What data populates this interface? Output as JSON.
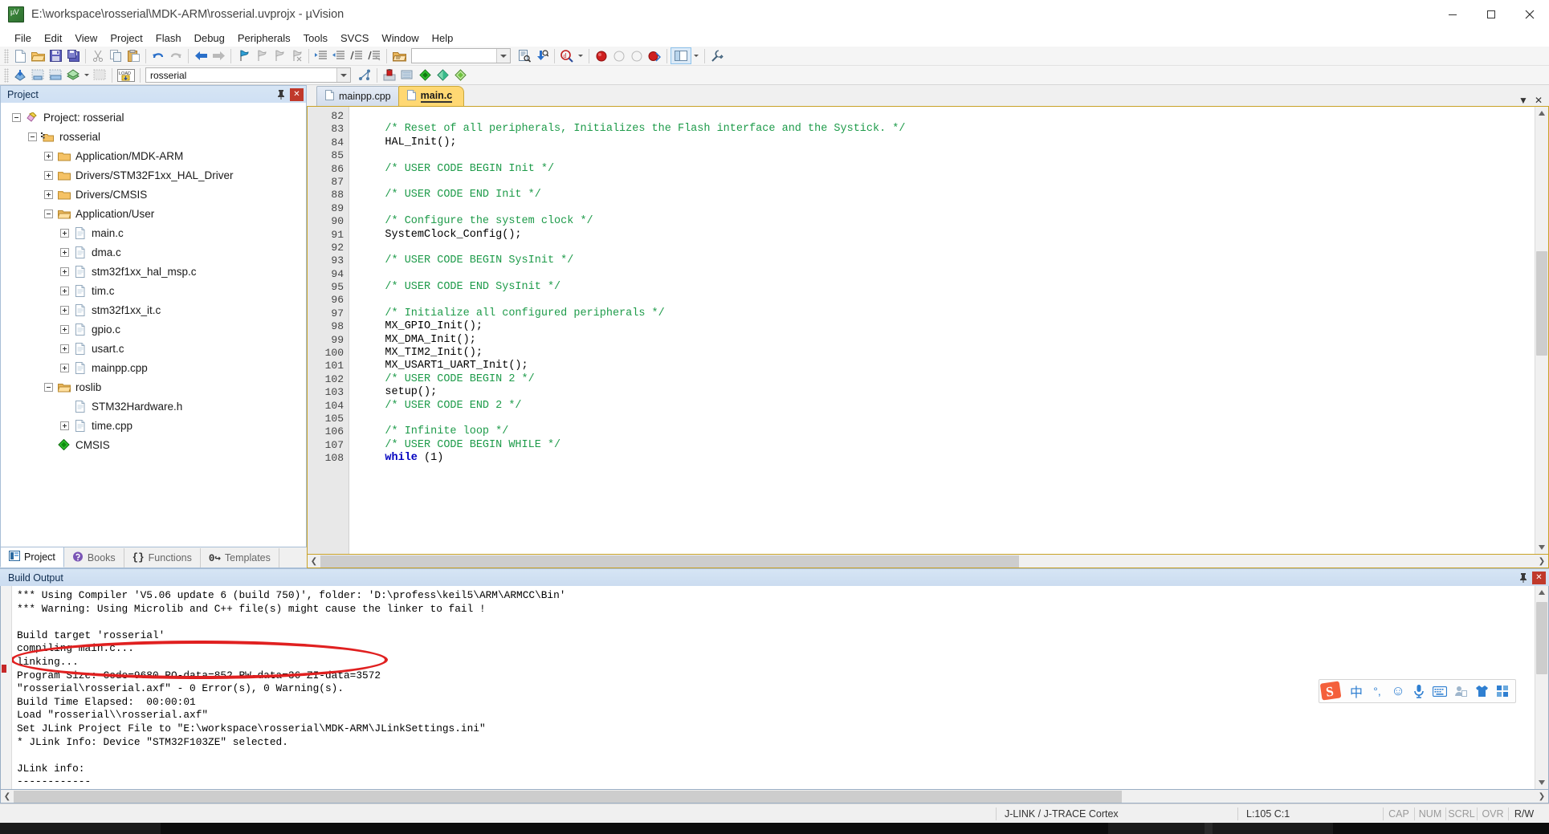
{
  "window": {
    "title": "E:\\workspace\\rosserial\\MDK-ARM\\rosserial.uvprojx - µVision",
    "app_icon": "uvision-icon",
    "minimize_label": "Minimize",
    "maximize_label": "Maximize",
    "close_label": "Close"
  },
  "menubar": {
    "items": [
      {
        "label": "File"
      },
      {
        "label": "Edit"
      },
      {
        "label": "View"
      },
      {
        "label": "Project"
      },
      {
        "label": "Flash"
      },
      {
        "label": "Debug"
      },
      {
        "label": "Peripherals"
      },
      {
        "label": "Tools"
      },
      {
        "label": "SVCS"
      },
      {
        "label": "Window"
      },
      {
        "label": "Help"
      }
    ]
  },
  "toolbar_main": {
    "icons": [
      "new-file-icon",
      "open-file-icon",
      "save-icon",
      "save-all-icon",
      "cut-icon",
      "copy-icon",
      "paste-icon",
      "undo-icon",
      "redo-icon",
      "navigate-back-icon",
      "navigate-forward-icon",
      "bookmark-toggle-icon",
      "bookmark-prev-icon",
      "bookmark-next-icon",
      "bookmark-clear-icon",
      "indent-icon",
      "outdent-icon",
      "comment-icon",
      "uncomment-icon",
      "open-folder-icon"
    ],
    "search_box_value": "",
    "search_box_placeholder": "",
    "right_icons": [
      "find-in-files-icon",
      "incremental-find-icon",
      "search-target-icon",
      "debug-start-icon"
    ]
  },
  "toolbar_build": {
    "icons": [
      "translate-icon",
      "build-icon",
      "rebuild-icon",
      "batch-build-icon",
      "stop-build-icon",
      "download-icon"
    ],
    "target_select_value": "rosserial",
    "right_icons": [
      "target-options-icon",
      "manage-runtime-icon",
      "pack-installer-icon",
      "configure-icon",
      "environment-icon"
    ]
  },
  "project_panel": {
    "title": "Project",
    "pin_icon": "pin-icon",
    "close_icon": "close-icon",
    "tree": [
      {
        "label": "Project: rosserial",
        "depth": 0,
        "icon": "project-icon",
        "expander": "minus"
      },
      {
        "label": "rosserial",
        "depth": 1,
        "icon": "target-folder-icon",
        "expander": "minus"
      },
      {
        "label": "Application/MDK-ARM",
        "depth": 2,
        "icon": "folder-icon",
        "expander": "plus"
      },
      {
        "label": "Drivers/STM32F1xx_HAL_Driver",
        "depth": 2,
        "icon": "folder-icon",
        "expander": "plus"
      },
      {
        "label": "Drivers/CMSIS",
        "depth": 2,
        "icon": "folder-icon",
        "expander": "plus"
      },
      {
        "label": "Application/User",
        "depth": 2,
        "icon": "folder-open-icon",
        "expander": "minus"
      },
      {
        "label": "main.c",
        "depth": 3,
        "icon": "c-file-icon",
        "expander": "plus"
      },
      {
        "label": "dma.c",
        "depth": 3,
        "icon": "c-file-icon",
        "expander": "plus"
      },
      {
        "label": "stm32f1xx_hal_msp.c",
        "depth": 3,
        "icon": "c-file-icon",
        "expander": "plus"
      },
      {
        "label": "tim.c",
        "depth": 3,
        "icon": "c-file-icon",
        "expander": "plus"
      },
      {
        "label": "stm32f1xx_it.c",
        "depth": 3,
        "icon": "c-file-icon",
        "expander": "plus"
      },
      {
        "label": "gpio.c",
        "depth": 3,
        "icon": "c-file-icon",
        "expander": "plus"
      },
      {
        "label": "usart.c",
        "depth": 3,
        "icon": "c-file-icon",
        "expander": "plus"
      },
      {
        "label": "mainpp.cpp",
        "depth": 3,
        "icon": "cpp-file-icon",
        "expander": "plus"
      },
      {
        "label": "roslib",
        "depth": 2,
        "icon": "folder-open-icon",
        "expander": "minus"
      },
      {
        "label": "STM32Hardware.h",
        "depth": 3,
        "icon": "h-file-icon",
        "expander": "none"
      },
      {
        "label": "time.cpp",
        "depth": 3,
        "icon": "cpp-file-icon",
        "expander": "plus"
      },
      {
        "label": "CMSIS",
        "depth": 2,
        "icon": "cmsis-component-icon",
        "expander": "none"
      }
    ],
    "tabs": [
      {
        "label": "Project",
        "icon": "project-tab-icon",
        "active": true
      },
      {
        "label": "Books",
        "icon": "books-tab-icon",
        "active": false
      },
      {
        "label": "Functions",
        "icon": "functions-tab-icon",
        "active": false
      },
      {
        "label": "Templates",
        "icon": "templates-tab-icon",
        "active": false
      }
    ]
  },
  "editor": {
    "tabs": [
      {
        "label": "mainpp.cpp",
        "active": false,
        "icon": "source-file-icon"
      },
      {
        "label": "main.c",
        "active": true,
        "icon": "source-file-icon"
      }
    ],
    "panel_icons": [
      "chevron-down-icon",
      "close-icon"
    ],
    "first_line_number": 82,
    "lines": [
      {
        "n": 82,
        "segments": []
      },
      {
        "n": 83,
        "segments": [
          {
            "t": "    ",
            "c": ""
          },
          {
            "t": "/* Reset of all peripherals, Initializes the Flash interface and the Systick. */",
            "c": "cm"
          }
        ]
      },
      {
        "n": 84,
        "segments": [
          {
            "t": "    HAL_Init();",
            "c": ""
          }
        ]
      },
      {
        "n": 85,
        "segments": []
      },
      {
        "n": 86,
        "segments": [
          {
            "t": "    ",
            "c": ""
          },
          {
            "t": "/* USER CODE BEGIN Init */",
            "c": "cm"
          }
        ]
      },
      {
        "n": 87,
        "segments": []
      },
      {
        "n": 88,
        "segments": [
          {
            "t": "    ",
            "c": ""
          },
          {
            "t": "/* USER CODE END Init */",
            "c": "cm"
          }
        ]
      },
      {
        "n": 89,
        "segments": []
      },
      {
        "n": 90,
        "segments": [
          {
            "t": "    ",
            "c": ""
          },
          {
            "t": "/* Configure the system clock */",
            "c": "cm"
          }
        ]
      },
      {
        "n": 91,
        "segments": [
          {
            "t": "    SystemClock_Config();",
            "c": ""
          }
        ]
      },
      {
        "n": 92,
        "segments": []
      },
      {
        "n": 93,
        "segments": [
          {
            "t": "    ",
            "c": ""
          },
          {
            "t": "/* USER CODE BEGIN SysInit */",
            "c": "cm"
          }
        ]
      },
      {
        "n": 94,
        "segments": []
      },
      {
        "n": 95,
        "segments": [
          {
            "t": "    ",
            "c": ""
          },
          {
            "t": "/* USER CODE END SysInit */",
            "c": "cm"
          }
        ]
      },
      {
        "n": 96,
        "segments": []
      },
      {
        "n": 97,
        "segments": [
          {
            "t": "    ",
            "c": ""
          },
          {
            "t": "/* Initialize all configured peripherals */",
            "c": "cm"
          }
        ]
      },
      {
        "n": 98,
        "segments": [
          {
            "t": "    MX_GPIO_Init();",
            "c": ""
          }
        ]
      },
      {
        "n": 99,
        "segments": [
          {
            "t": "    MX_DMA_Init();",
            "c": ""
          }
        ]
      },
      {
        "n": 100,
        "segments": [
          {
            "t": "    MX_TIM2_Init();",
            "c": ""
          }
        ]
      },
      {
        "n": 101,
        "segments": [
          {
            "t": "    MX_USART1_UART_Init();",
            "c": ""
          }
        ]
      },
      {
        "n": 102,
        "segments": [
          {
            "t": "    ",
            "c": ""
          },
          {
            "t": "/* USER CODE BEGIN 2 */",
            "c": "cm"
          }
        ]
      },
      {
        "n": 103,
        "segments": [
          {
            "t": "    setup();",
            "c": ""
          }
        ]
      },
      {
        "n": 104,
        "segments": [
          {
            "t": "    ",
            "c": ""
          },
          {
            "t": "/* USER CODE END 2 */",
            "c": "cm"
          }
        ]
      },
      {
        "n": 105,
        "segments": []
      },
      {
        "n": 106,
        "segments": [
          {
            "t": "    ",
            "c": ""
          },
          {
            "t": "/* Infinite loop */",
            "c": "cm"
          }
        ]
      },
      {
        "n": 107,
        "segments": [
          {
            "t": "    ",
            "c": ""
          },
          {
            "t": "/* USER CODE BEGIN WHILE */",
            "c": "cm"
          }
        ]
      },
      {
        "n": 108,
        "segments": [
          {
            "t": "    ",
            "c": ""
          },
          {
            "t": "while",
            "c": "ck"
          },
          {
            "t": " (1)",
            "c": ""
          }
        ]
      }
    ]
  },
  "build_output": {
    "title": "Build Output",
    "pin_icon": "pin-icon",
    "close_icon": "close-icon",
    "lines": [
      "*** Using Compiler 'V5.06 update 6 (build 750)', folder: 'D:\\profess\\keil5\\ARM\\ARMCC\\Bin'",
      "*** Warning: Using Microlib and C++ file(s) might cause the linker to fail !",
      "",
      "Build target 'rosserial'",
      "compiling main.c...",
      "linking...",
      "Program Size: Code=9680 RO-data=852 RW-data=36 ZI-data=3572",
      "\"rosserial\\rosserial.axf\" - 0 Error(s), 0 Warning(s).",
      "Build Time Elapsed:  00:00:01",
      "Load \"rosserial\\\\rosserial.axf\"",
      "Set JLink Project File to \"E:\\workspace\\rosserial\\MDK-ARM\\JLinkSettings.ini\"",
      "* JLink Info: Device \"STM32F103ZE\" selected.",
      "",
      "JLink info:",
      "------------"
    ],
    "annotation": {
      "shape": "ellipse",
      "color": "#e02020",
      "covers_lines": [
        "Program Size: Code=9680 RO-data=852 RW-data=36 ZI-data=3572",
        "\"rosserial\\rosserial.axf\" - 0 Error(s), 0 Warning(s).",
        "Build Time Elapsed:  00:00:01"
      ]
    }
  },
  "ime_toolbar": {
    "name": "sogou-input-method-toolbar",
    "logo": "sogou-logo-icon",
    "buttons": [
      {
        "icon": "chinese-mode-icon",
        "label": "中"
      },
      {
        "icon": "punctuation-icon",
        "label": "°,"
      },
      {
        "icon": "emoji-icon",
        "label": "☺"
      },
      {
        "icon": "voice-input-icon",
        "label": "🎤"
      },
      {
        "icon": "soft-keyboard-icon",
        "label": "⌨"
      },
      {
        "icon": "user-account-icon",
        "label": "👤"
      },
      {
        "icon": "skin-icon",
        "label": "👕"
      },
      {
        "icon": "toolbox-icon",
        "label": "▦"
      }
    ]
  },
  "statusbar": {
    "debug_adapter": "J-LINK / J-TRACE Cortex",
    "cursor_position": "L:105 C:1",
    "indicators": [
      {
        "label": "CAP",
        "active": false
      },
      {
        "label": "NUM",
        "active": false
      },
      {
        "label": "SCRL",
        "active": false
      },
      {
        "label": "OVR",
        "active": false
      },
      {
        "label": "R/W",
        "active": true
      }
    ]
  },
  "colors": {
    "accent_tab": "#ffd873",
    "panel_header": "#d6e5f5",
    "comment": "#1e9b4a",
    "keyword": "#0000c0",
    "annotation_red": "#e02020",
    "editor_border": "#c9a227"
  }
}
